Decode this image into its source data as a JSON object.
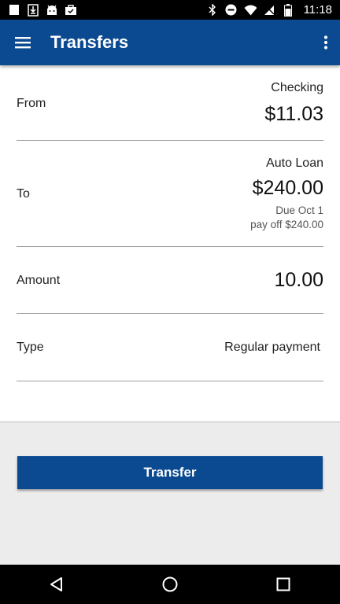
{
  "status_bar": {
    "time": "11:18",
    "left_icons": [
      "notification-icon",
      "download-icon",
      "android-icon",
      "shopping-bag-icon"
    ],
    "right_icons": [
      "bluetooth-icon",
      "do-not-disturb-icon",
      "wifi-icon",
      "no-sim-icon",
      "battery-icon"
    ]
  },
  "app_bar": {
    "title": "Transfers",
    "menu_icon": "hamburger-menu-icon",
    "overflow_icon": "more-vert-icon"
  },
  "form": {
    "from": {
      "label": "From",
      "account": "Checking",
      "balance": "$11.03"
    },
    "to": {
      "label": "To",
      "account": "Auto Loan",
      "balance": "$240.00",
      "due": "Due Oct 1",
      "payoff": "pay off $240.00"
    },
    "amount": {
      "label": "Amount",
      "value": "10.00"
    },
    "type": {
      "label": "Type",
      "value": "Regular payment"
    }
  },
  "actions": {
    "transfer_label": "Transfer"
  },
  "colors": {
    "primary": "#0b4a91",
    "background": "#ececec",
    "card": "#ffffff"
  }
}
